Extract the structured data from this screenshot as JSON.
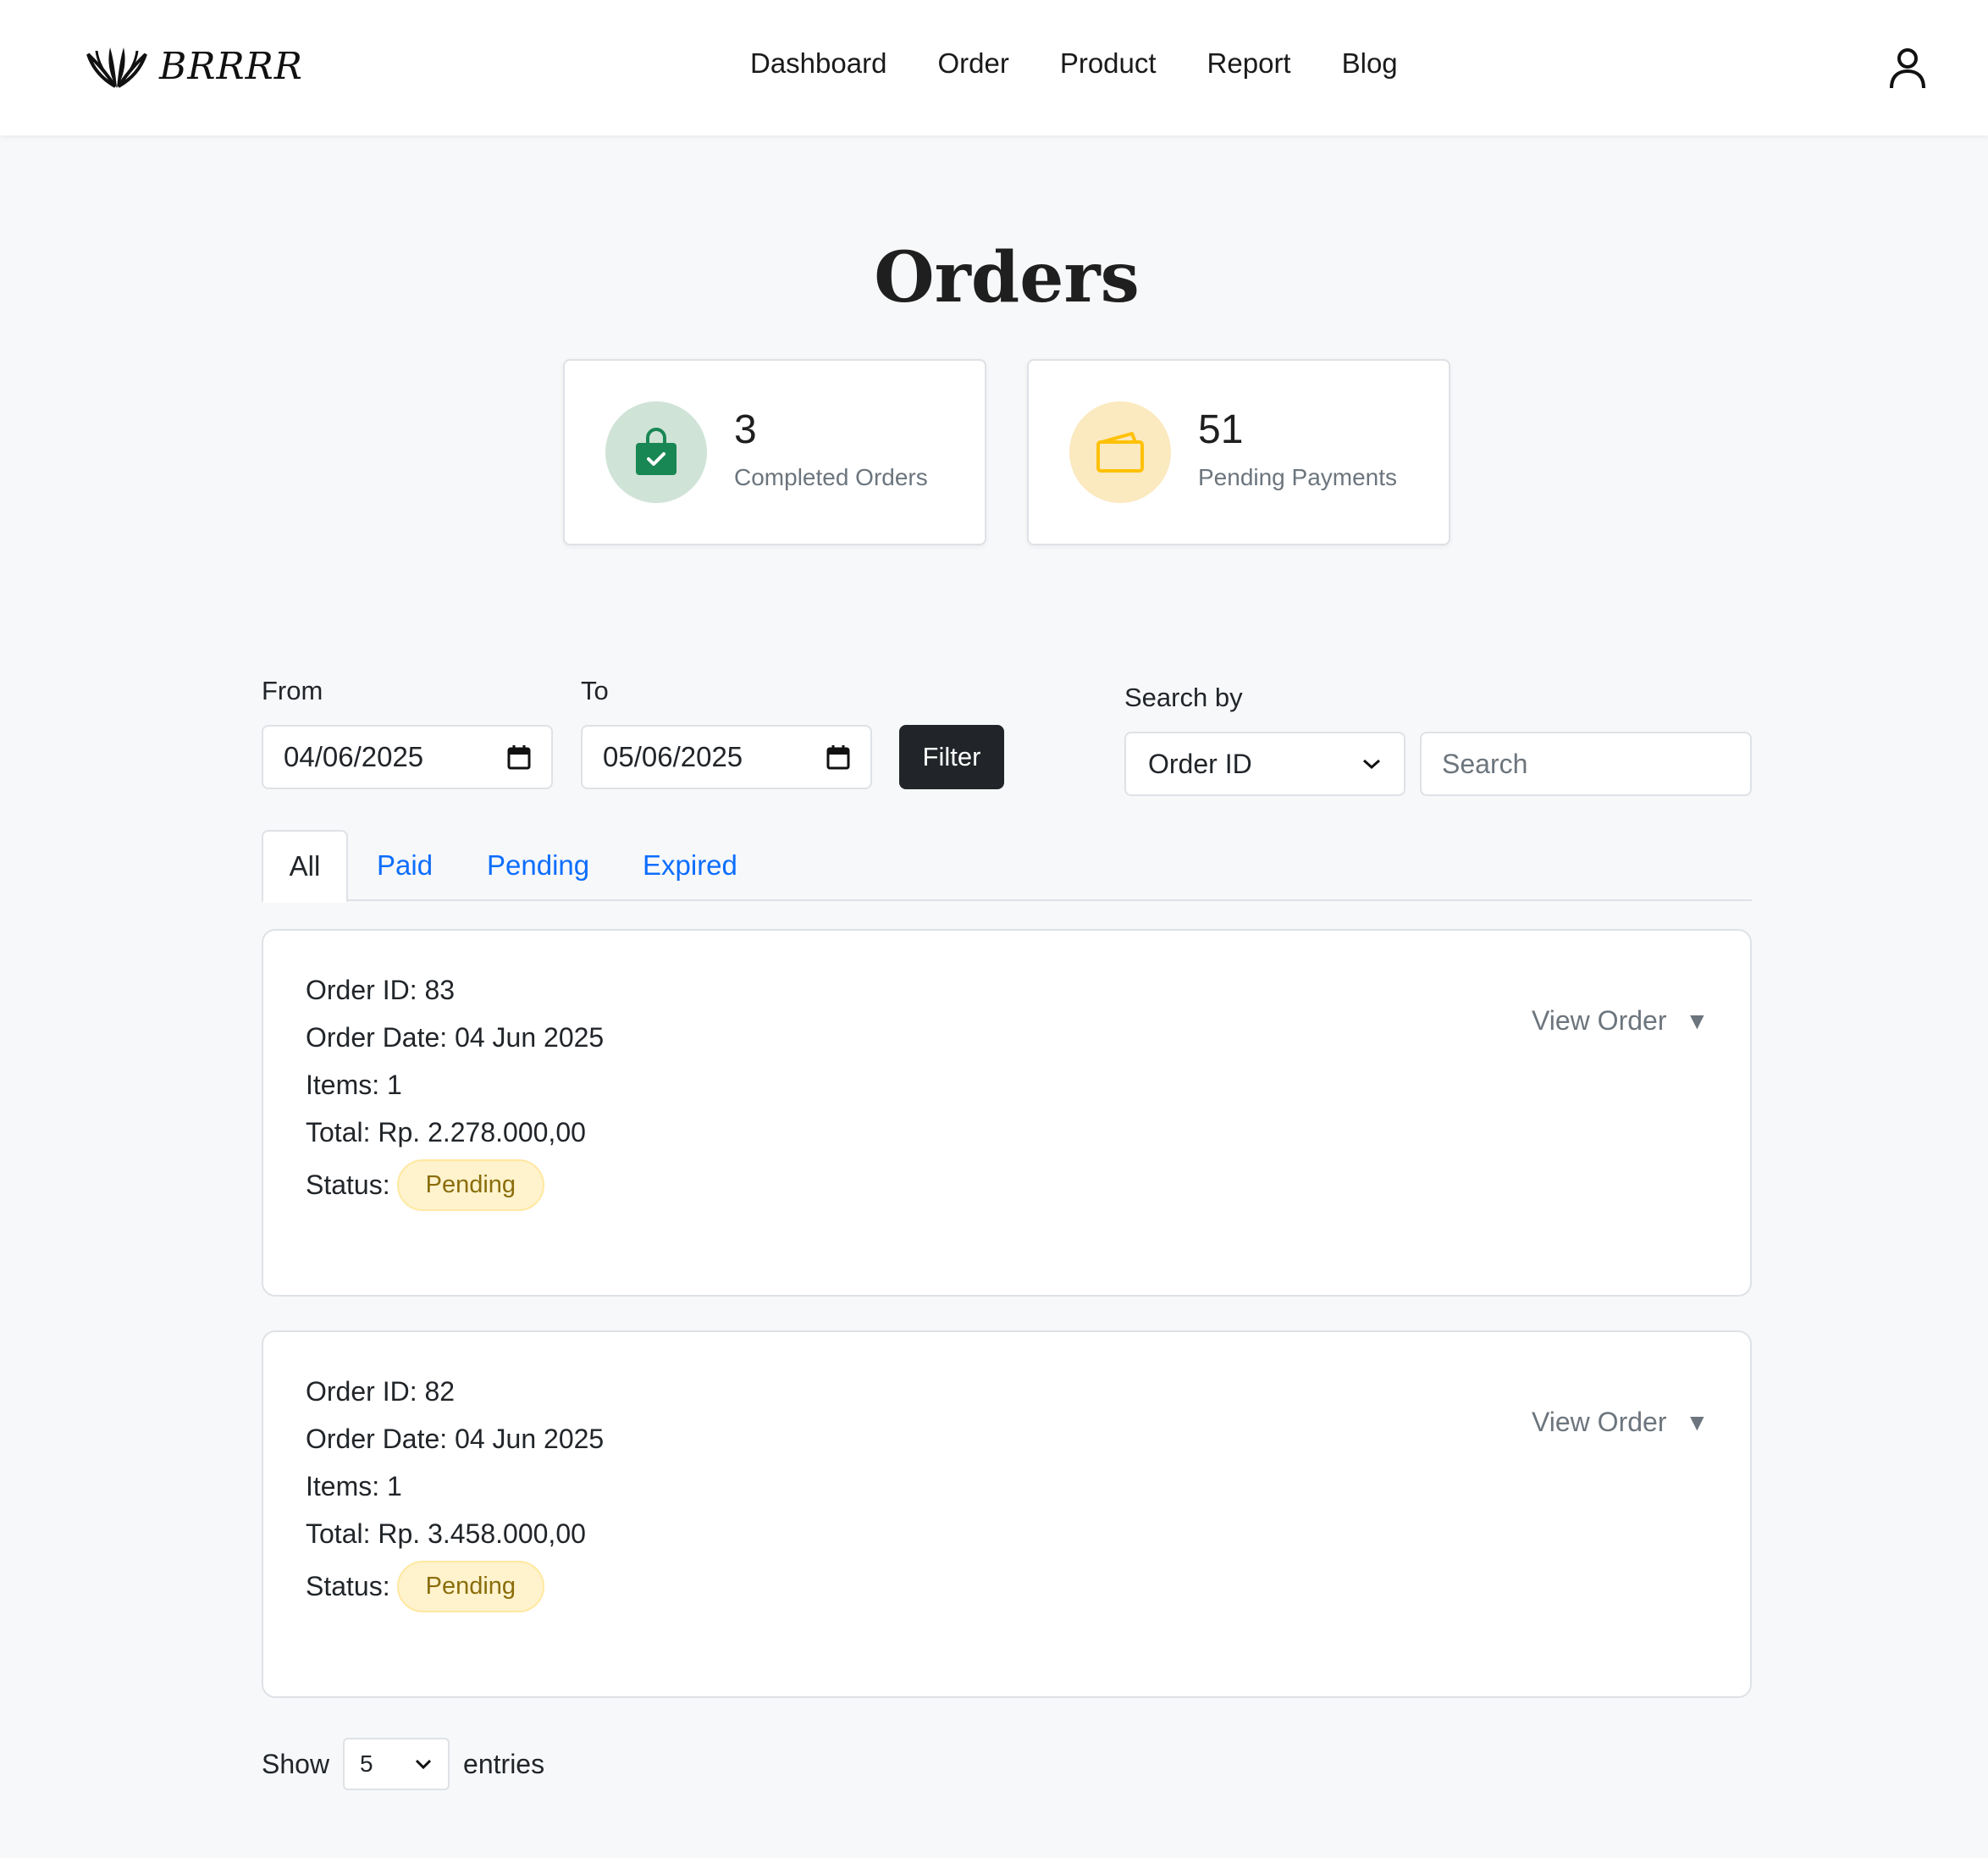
{
  "brand": {
    "name": "BRRRR"
  },
  "nav": {
    "items": [
      {
        "label": "Dashboard"
      },
      {
        "label": "Order"
      },
      {
        "label": "Product"
      },
      {
        "label": "Report"
      },
      {
        "label": "Blog"
      }
    ],
    "user_icon": "user-icon"
  },
  "page": {
    "title": "Orders"
  },
  "stats": [
    {
      "value": "3",
      "label": "Completed Orders",
      "icon": "shopping-bag-check-icon",
      "color": "#198754",
      "bg": "#cfe3d6"
    },
    {
      "value": "51",
      "label": "Pending Payments",
      "icon": "wallet-icon",
      "color": "#ffc107",
      "bg": "#fbe9bf"
    }
  ],
  "filter": {
    "from_label": "From",
    "from_value": "04/06/2025",
    "to_label": "To",
    "to_value": "05/06/2025",
    "filter_button": "Filter",
    "search_by_label": "Search by",
    "search_by_value": "Order ID",
    "search_placeholder": "Search"
  },
  "tabs": [
    {
      "label": "All",
      "active": true
    },
    {
      "label": "Paid"
    },
    {
      "label": "Pending"
    },
    {
      "label": "Expired"
    }
  ],
  "orders": [
    {
      "id_line": "Order ID: 83",
      "date_line": "Order Date: 04 Jun 2025",
      "items_line": "Items: 1",
      "total_line": "Total: Rp. 2.278.000,00",
      "status_label": "Status:",
      "status": "Pending",
      "view_label": "View Order"
    },
    {
      "id_line": "Order ID: 82",
      "date_line": "Order Date: 04 Jun 2025",
      "items_line": "Items: 1",
      "total_line": "Total: Rp. 3.458.000,00",
      "status_label": "Status:",
      "status": "Pending",
      "view_label": "View Order"
    }
  ],
  "pagination": {
    "show_label": "Show",
    "entries_value": "5",
    "entries_label": "entries"
  },
  "colors": {
    "primary": "#0d6efd",
    "dark": "#212529",
    "pending_bg": "#fff3cd",
    "pending_text": "#8a6d0b"
  }
}
